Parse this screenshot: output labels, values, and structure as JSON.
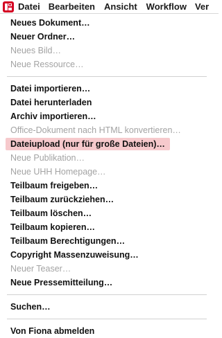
{
  "menubar": {
    "logo": "fiona-logo-icon",
    "accent_color": "#d40022",
    "items": [
      "Datei",
      "Bearbeiten",
      "Ansicht",
      "Workflow",
      "Ver"
    ]
  },
  "menu": {
    "highlight_color": "#f6c9cc",
    "groups": [
      {
        "items": [
          {
            "label": "Neues Dokument…",
            "disabled": false
          },
          {
            "label": "Neuer Ordner…",
            "disabled": false
          },
          {
            "label": "Neues Bild…",
            "disabled": true
          },
          {
            "label": "Neue Ressource…",
            "disabled": true
          }
        ]
      },
      {
        "items": [
          {
            "label": "Datei importieren…",
            "disabled": false
          },
          {
            "label": "Datei herunterladen",
            "disabled": false
          },
          {
            "label": "Archiv importieren…",
            "disabled": false
          },
          {
            "label": "Office-Dokument nach HTML konvertieren…",
            "disabled": true
          },
          {
            "label": "Dateiupload (nur für große Dateien)…",
            "disabled": false,
            "highlighted": true
          },
          {
            "label": "Neue Publikation…",
            "disabled": true
          },
          {
            "label": "Neue UHH Homepage…",
            "disabled": true
          },
          {
            "label": "Teilbaum freigeben…",
            "disabled": false
          },
          {
            "label": "Teilbaum zurückziehen…",
            "disabled": false
          },
          {
            "label": "Teilbaum löschen…",
            "disabled": false
          },
          {
            "label": "Teilbaum kopieren…",
            "disabled": false
          },
          {
            "label": "Teilbaum Berechtigungen…",
            "disabled": false
          },
          {
            "label": "Copyright Massenzuweisung…",
            "disabled": false
          },
          {
            "label": "Neuer Teaser…",
            "disabled": true
          },
          {
            "label": "Neue Pressemitteilung…",
            "disabled": false
          }
        ]
      },
      {
        "items": [
          {
            "label": "Suchen…",
            "disabled": false
          }
        ]
      },
      {
        "items": [
          {
            "label": "Von Fiona abmelden",
            "disabled": false
          }
        ]
      }
    ]
  }
}
